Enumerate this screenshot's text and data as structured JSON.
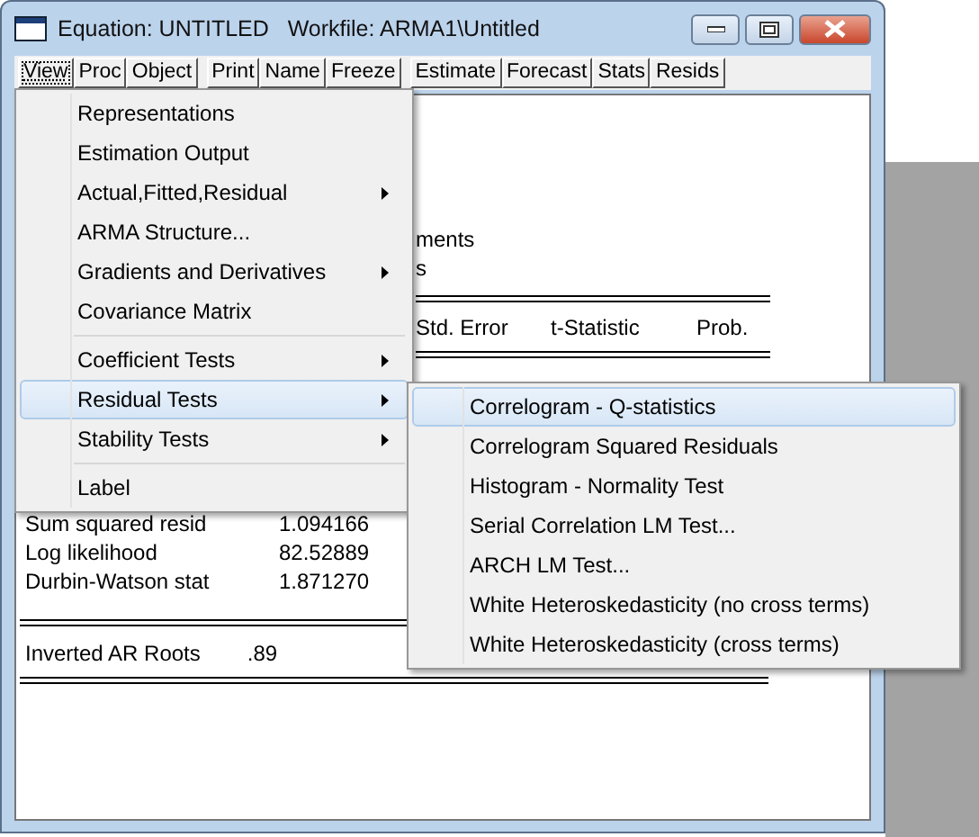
{
  "window": {
    "title": "Equation: UNTITLED   Workfile: ARMA1\\Untitled"
  },
  "toolbar_groups": [
    [
      {
        "label": "View",
        "selected": true
      },
      {
        "label": "Proc",
        "selected": false
      },
      {
        "label": "Object",
        "selected": false
      }
    ],
    [
      {
        "label": "Print",
        "selected": false
      },
      {
        "label": "Name",
        "selected": false
      },
      {
        "label": "Freeze",
        "selected": false
      }
    ],
    [
      {
        "label": "Estimate",
        "selected": false
      },
      {
        "label": "Forecast",
        "selected": false
      },
      {
        "label": "Stats",
        "selected": false
      },
      {
        "label": "Resids",
        "selected": false
      }
    ]
  ],
  "output": {
    "fragments": [
      "ments",
      "s"
    ],
    "columns": [
      "Std. Error",
      "t-Statistic",
      "Prob."
    ],
    "stats": [
      {
        "label": "Sum squared resid",
        "value": "1.094166"
      },
      {
        "label": "Log likelihood",
        "value": "82.52889"
      },
      {
        "label": "Durbin-Watson stat",
        "value": "1.871270"
      }
    ],
    "roots": {
      "label": "Inverted AR Roots",
      "value": ".89"
    }
  },
  "view_menu": [
    {
      "kind": "item",
      "label": "Representations",
      "submenu": false,
      "selected": false
    },
    {
      "kind": "item",
      "label": "Estimation Output",
      "submenu": false,
      "selected": false
    },
    {
      "kind": "item",
      "label": "Actual,Fitted,Residual",
      "submenu": true,
      "selected": false
    },
    {
      "kind": "item",
      "label": "ARMA Structure...",
      "submenu": false,
      "selected": false
    },
    {
      "kind": "item",
      "label": "Gradients and Derivatives",
      "submenu": true,
      "selected": false
    },
    {
      "kind": "item",
      "label": "Covariance Matrix",
      "submenu": false,
      "selected": false
    },
    {
      "kind": "separator"
    },
    {
      "kind": "item",
      "label": "Coefficient Tests",
      "submenu": true,
      "selected": false
    },
    {
      "kind": "item",
      "label": "Residual Tests",
      "submenu": true,
      "selected": true
    },
    {
      "kind": "item",
      "label": "Stability Tests",
      "submenu": true,
      "selected": false
    },
    {
      "kind": "separator"
    },
    {
      "kind": "item",
      "label": "Label",
      "submenu": false,
      "selected": false
    }
  ],
  "residual_submenu": [
    {
      "label": "Correlogram - Q-statistics",
      "selected": true
    },
    {
      "label": "Correlogram Squared Residuals",
      "selected": false
    },
    {
      "label": "Histogram - Normality Test",
      "selected": false
    },
    {
      "label": "Serial Correlation LM Test...",
      "selected": false
    },
    {
      "label": "ARCH LM Test...",
      "selected": false
    },
    {
      "label": "White Heteroskedasticity (no cross terms)",
      "selected": false
    },
    {
      "label": "White Heteroskedasticity (cross terms)",
      "selected": false
    }
  ]
}
